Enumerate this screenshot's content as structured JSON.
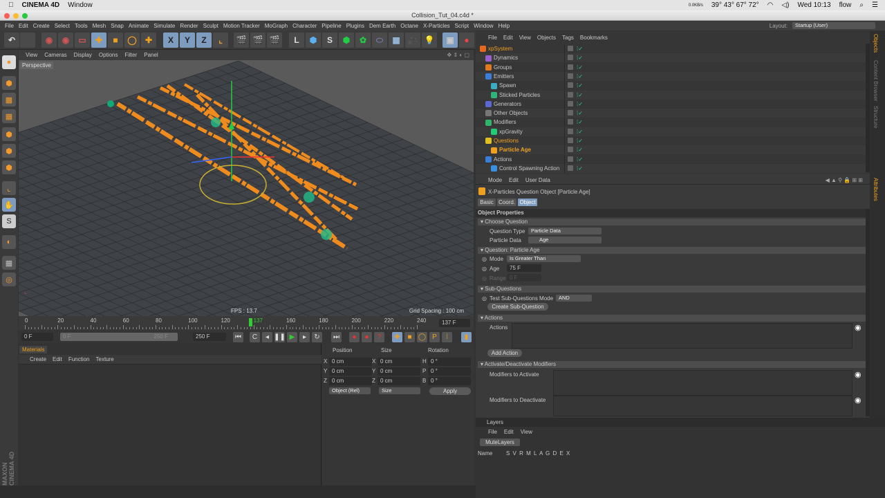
{
  "mac_menu": {
    "app": "CINEMA 4D",
    "items": [
      "Window"
    ],
    "status": {
      "net": "0.0KB/s",
      "temps": "39° 43° 67° 72°",
      "clock": "Wed 10:13",
      "user": "flow"
    }
  },
  "window": {
    "title": "Collision_Tut_04.c4d *"
  },
  "menu": [
    "File",
    "Edit",
    "Create",
    "Select",
    "Tools",
    "Mesh",
    "Snap",
    "Animate",
    "Simulate",
    "Render",
    "Sculpt",
    "Motion Tracker",
    "MoGraph",
    "Character",
    "Pipeline",
    "Plugins",
    "Dem Earth",
    "Octane",
    "X-Particles",
    "Script",
    "Window",
    "Help"
  ],
  "layout": {
    "label": "Layout:",
    "value": "Startup (User)"
  },
  "toolbar": {
    "x": "X",
    "y": "Y",
    "z": "Z"
  },
  "viewport": {
    "menu": [
      "View",
      "Cameras",
      "Display",
      "Options",
      "Filter",
      "Panel"
    ],
    "camera": "Perspective",
    "fps": "FPS : 13.7",
    "grid": "Grid Spacing : 100 cm",
    "accent": "#f08c1e"
  },
  "timeline": {
    "ticks": [
      "0",
      "20",
      "40",
      "60",
      "80",
      "100",
      "120",
      "137",
      "160",
      "180",
      "200",
      "220",
      "240"
    ],
    "current": "137",
    "current_field": "137 F",
    "current_frame": 137,
    "max_frame": 250
  },
  "playback": {
    "start": "0 F",
    "range_start": "0 F",
    "range_end": "250 F",
    "end": "250 F"
  },
  "materials": {
    "tab": "Materials",
    "menu": [
      "Create",
      "Edit",
      "Function",
      "Texture"
    ]
  },
  "coords": {
    "headers": [
      "Position",
      "Size",
      "Rotation"
    ],
    "rows": [
      {
        "a": "X",
        "p": "0 cm",
        "b": "X",
        "s": "0 cm",
        "c": "H",
        "r": "0 °"
      },
      {
        "a": "Y",
        "p": "0 cm",
        "b": "Y",
        "s": "0 cm",
        "c": "P",
        "r": "0 °"
      },
      {
        "a": "Z",
        "p": "0 cm",
        "b": "Z",
        "s": "0 cm",
        "c": "B",
        "r": "0 °"
      }
    ],
    "mode": "Object (Rel)",
    "size_mode": "Size",
    "apply": "Apply"
  },
  "objects": {
    "menu": [
      "File",
      "Edit",
      "View",
      "Objects",
      "Tags",
      "Bookmarks"
    ],
    "items": [
      {
        "name": "xpSystem",
        "level": 0,
        "color": "#e8671f",
        "hl": true
      },
      {
        "name": "Dynamics",
        "level": 1,
        "color": "#9b5fd0"
      },
      {
        "name": "Groups",
        "level": 1,
        "color": "#e07a1f"
      },
      {
        "name": "Emitters",
        "level": 1,
        "color": "#3a7fd5"
      },
      {
        "name": "Spawn",
        "level": 2,
        "color": "#3aaec0"
      },
      {
        "name": "Sticked Particles",
        "level": 2,
        "color": "#2fb47a"
      },
      {
        "name": "Generators",
        "level": 1,
        "color": "#5a68d0"
      },
      {
        "name": "Other Objects",
        "level": 1,
        "color": "#777777"
      },
      {
        "name": "Modifiers",
        "level": 1,
        "color": "#2fb46a"
      },
      {
        "name": "xpGravity",
        "level": 2,
        "color": "#22cc77"
      },
      {
        "name": "Questions",
        "level": 1,
        "color": "#e0c020",
        "hl": true
      },
      {
        "name": "Particle Age",
        "level": 2,
        "color": "#f0a020",
        "hl": true,
        "bold": true
      },
      {
        "name": "Actions",
        "level": 1,
        "color": "#3a7fd5"
      },
      {
        "name": "Control Spawning Action",
        "level": 2,
        "color": "#3a8fe0"
      }
    ]
  },
  "attributes": {
    "menu": [
      "Mode",
      "Edit",
      "User Data"
    ],
    "title": "X-Particles Question Object [Particle Age]",
    "tabs": [
      "Basic",
      "Coord.",
      "Object"
    ],
    "object_properties": "Object Properties",
    "choose_question": "Choose Question",
    "question_type_label": "Question Type",
    "question_type": "Particle Data",
    "particle_data_label": "Particle Data",
    "particle_data": "Age",
    "question_section": "Question: Particle Age",
    "mode_label": "Mode",
    "mode": "Is Greater Than",
    "age_label": "Age",
    "age": "75 F",
    "range_label": "Range",
    "range": "0 F",
    "subq_section": "Sub-Questions",
    "subq_mode_label": "Test Sub-Questions Mode",
    "subq_mode": "AND",
    "create_subq": "Create Sub-Question",
    "actions_section": "Actions",
    "actions_label": "Actions",
    "add_action": "Add Action",
    "mod_section": "Activate/Deactivate Modifiers",
    "activate_label": "Modifiers to Activate",
    "deactivate_label": "Modifiers to Deactivate"
  },
  "layers": {
    "title": "Layers",
    "menu": [
      "File",
      "Edit",
      "View"
    ],
    "mute": "MuteLayers",
    "name_col": "Name",
    "cols": "S V R M L A G D E X"
  },
  "side_tabs": [
    "Objects",
    "Content Browser",
    "Structure",
    "Attributes"
  ],
  "brand": "MAXON CINEMA 4D"
}
